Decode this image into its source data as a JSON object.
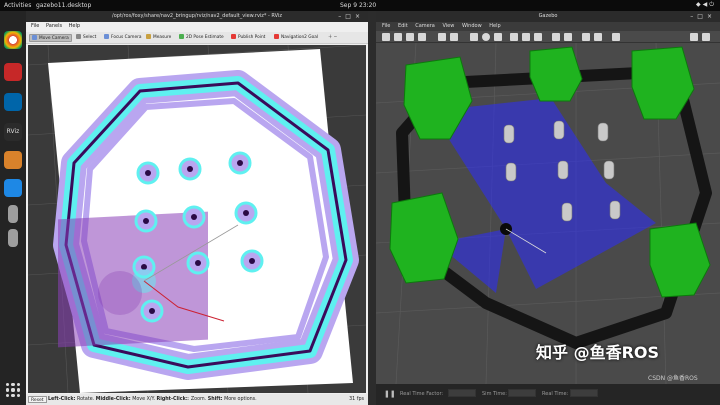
{
  "topbar": {
    "activities": "Activities",
    "app": "gazebo11.desktop",
    "clock": "Sep 9  23:20",
    "tray_icons": [
      "network-icon",
      "volume-icon",
      "power-icon"
    ]
  },
  "rviz": {
    "title": "/opt/ros/foxy/share/nav2_bringup/rviz/nav2_default_view.rviz* - RViz",
    "menu": [
      "File",
      "Panels",
      "Help"
    ],
    "tools": [
      {
        "label": "Move Camera",
        "active": true
      },
      {
        "label": "Select"
      },
      {
        "label": "Focus Camera"
      },
      {
        "label": "Measure"
      },
      {
        "label": "2D Pose Estimate"
      },
      {
        "label": "Publish Point"
      },
      {
        "label": "Navigation2 Goal"
      }
    ],
    "status": {
      "reset": "Reset",
      "hint_left_key": "Left-Click:",
      "hint_left_val": " Rotate. ",
      "hint_mid_key": "Middle-Click:",
      "hint_mid_val": " Move X/Y. ",
      "hint_right_key": "Right-Click:",
      "hint_right_val": ": Zoom. ",
      "hint_shift_key": "Shift:",
      "hint_shift_val": " More options.",
      "fps": "31 fps"
    }
  },
  "gazebo": {
    "title": "Gazebo",
    "menu": [
      "File",
      "Edit",
      "Camera",
      "View",
      "Window",
      "Help"
    ],
    "bottom": {
      "real_time_factor": "Real Time Factor:",
      "sim_time": "Sim Time:",
      "real_time": "Real Time:"
    }
  },
  "watermark": {
    "main": "知乎 @鱼香ROS",
    "sub": "CSDN @鱼香ROS"
  },
  "colors": {
    "map_free": "#ffffff",
    "costmap_cyan": "#5ff0f0",
    "costmap_lilac": "#b9a6f0",
    "costmap_purple": "#7b2da8",
    "wall_green": "#1fb31f",
    "laser_blue": "#2c2cff"
  }
}
